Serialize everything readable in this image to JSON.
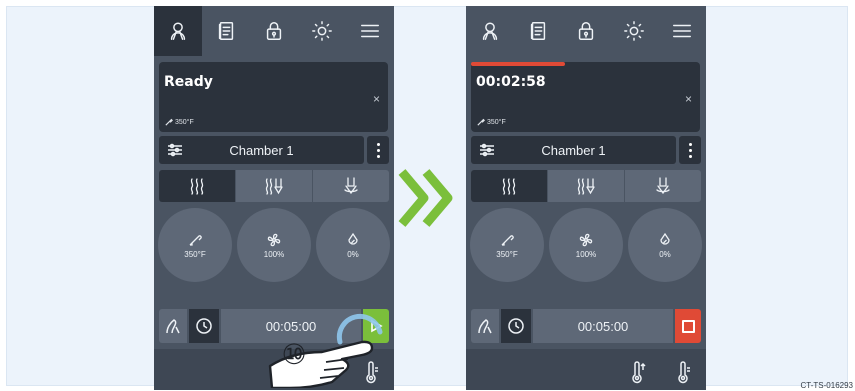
{
  "colors": {
    "screen_bg": "#4a5462",
    "panel_dark": "#2b323c",
    "panel_mid": "#5e6877",
    "start_green": "#7bbf3b",
    "stop_red": "#e04a36",
    "arrow_green": "#7bbf3b"
  },
  "left_screen": {
    "topbar_icons": [
      "user-chef-icon",
      "recipe-book-icon",
      "lock-icon",
      "brightness-icon",
      "menu-icon"
    ],
    "status": {
      "title": "Ready",
      "temperature": "350°F",
      "close_glyph": "×"
    },
    "chamber": {
      "label": "Chamber 1"
    },
    "modes": [
      "convection-heat-icon",
      "combi-steam-icon",
      "steam-icon"
    ],
    "dials": [
      {
        "icon": "thermometer-icon",
        "value": "350°F"
      },
      {
        "icon": "fan-icon",
        "value": "100%"
      },
      {
        "icon": "humidity-drop-icon",
        "value": "0%"
      }
    ],
    "timer": {
      "value": "00:05:00",
      "action": "start"
    },
    "callout_step": "⑩"
  },
  "right_screen": {
    "topbar_icons": [
      "user-chef-icon",
      "recipe-book-icon",
      "lock-icon",
      "brightness-icon",
      "menu-icon"
    ],
    "status": {
      "title": "00:02:58",
      "temperature": "350°F",
      "close_glyph": "×",
      "progress_fraction": 0.41
    },
    "chamber": {
      "label": "Chamber 1"
    },
    "modes": [
      "convection-heat-icon",
      "combi-steam-icon",
      "steam-icon"
    ],
    "dials": [
      {
        "icon": "thermometer-icon",
        "value": "350°F"
      },
      {
        "icon": "fan-icon",
        "value": "100%"
      },
      {
        "icon": "humidity-drop-icon",
        "value": "0%"
      }
    ],
    "timer": {
      "value": "00:05:00",
      "action": "stop"
    }
  },
  "footnote": "CT-TS-016293"
}
